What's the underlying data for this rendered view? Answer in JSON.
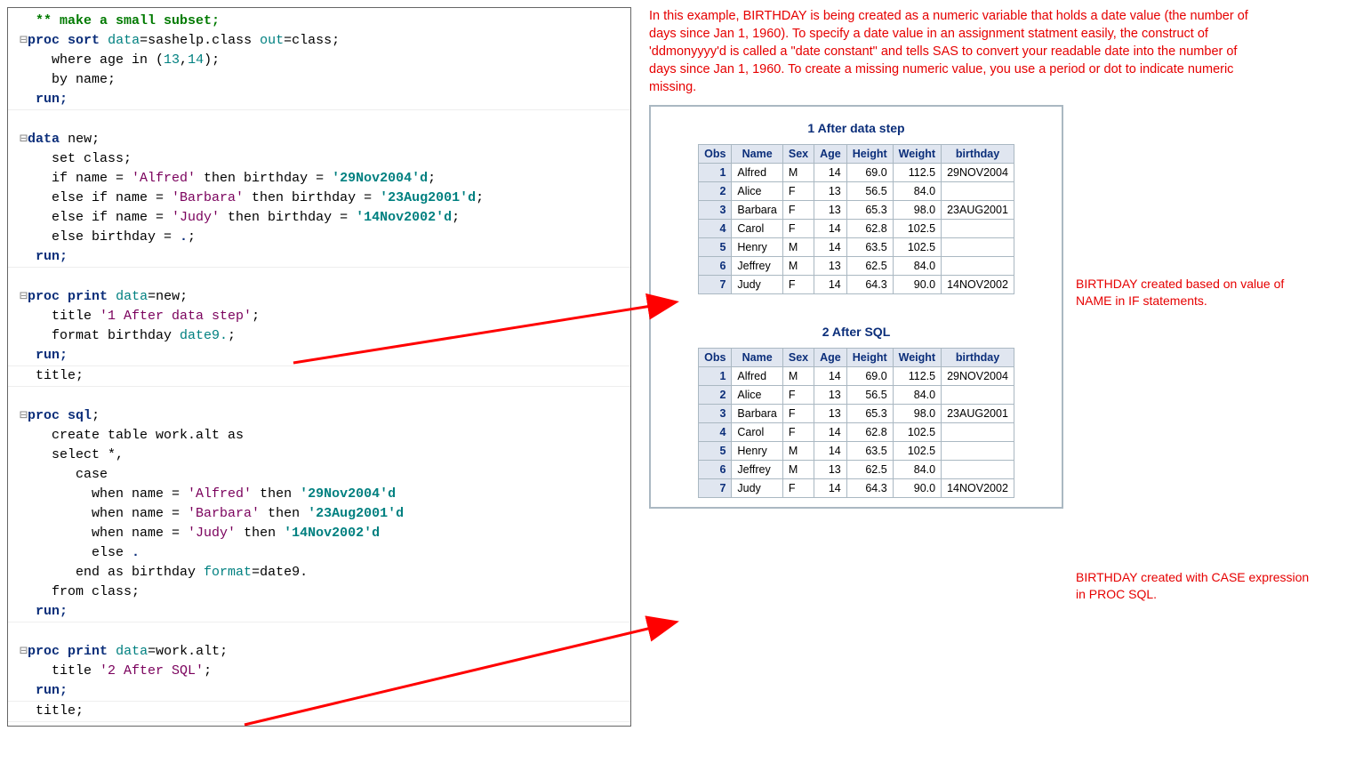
{
  "code": {
    "c01": "   ** make a small subset;",
    "c02a": " ⊟",
    "c02b": "proc sort",
    "c02c": " data",
    "c02d": "=sashelp.class ",
    "c02e": "out",
    "c02f": "=class;",
    "c03a": "     where age in (",
    "c03b": "13",
    "c03c": ",",
    "c03d": "14",
    "c03e": ");",
    "c04": "     by name;",
    "c05": "   run;",
    "c06": "",
    "c07a": " ⊟",
    "c07b": "data",
    "c07c": " new;",
    "c08": "     set class;",
    "c09a": "     if name = ",
    "c09b": "'Alfred'",
    "c09c": " then birthday = ",
    "c09d": "'29Nov2004'd",
    "c09e": ";",
    "c10a": "     else if name = ",
    "c10b": "'Barbara'",
    "c10c": " then birthday = ",
    "c10d": "'23Aug2001'd",
    "c10e": ";",
    "c11a": "     else if name = ",
    "c11b": "'Judy'",
    "c11c": " then birthday = ",
    "c11d": "'14Nov2002'd",
    "c11e": ";",
    "c12a": "     else birthday = ",
    "c12b": ".",
    "c12c": ";",
    "c13": "   run;",
    "c14": "",
    "c15a": " ⊟",
    "c15b": "proc print",
    "c15c": " data",
    "c15d": "=new;",
    "c16a": "     title ",
    "c16b": "'1 After data step'",
    "c16c": ";",
    "c17a": "     format birthday ",
    "c17b": "date9.",
    "c17c": ";",
    "c18": "   run;",
    "c19": "   title;",
    "c20": "",
    "c21a": " ⊟",
    "c21b": "proc sql",
    "c21c": ";",
    "c22": "     create table work.alt as",
    "c23": "     select *,",
    "c24": "        case",
    "c25a": "          when name = ",
    "c25b": "'Alfred'",
    "c25c": " then ",
    "c25d": "'29Nov2004'd",
    "c26a": "          when name = ",
    "c26b": "'Barbara'",
    "c26c": " then ",
    "c26d": "'23Aug2001'd",
    "c27a": "          when name = ",
    "c27b": "'Judy'",
    "c27c": " then ",
    "c27d": "'14Nov2002'd",
    "c28a": "          else ",
    "c28b": ".",
    "c29a": "        end as birthday ",
    "c29b": "format",
    "c29c": "=date9.",
    "c30": "     from class;",
    "c31": "   run;",
    "c32": "",
    "c33a": " ⊟",
    "c33b": "proc print",
    "c33c": " data",
    "c33d": "=work.alt;",
    "c34a": "     title ",
    "c34b": "'2 After SQL'",
    "c34c": ";",
    "c35": "   run;",
    "c36": "   title;"
  },
  "explain_top": "In this example, BIRTHDAY is being created as a numeric variable that holds a date value (the number of days since Jan 1, 1960). To specify a date value in an assignment statment easily, the construct of 'ddmonyyyy'd is called a \"date constant\" and tells SAS to convert your readable date into the number of days since Jan 1, 1960. To create a missing numeric value, you use a period or dot to indicate numeric missing.",
  "note1": "BIRTHDAY created based on value of NAME in IF statements.",
  "note2": "BIRTHDAY created with CASE expression in PROC SQL.",
  "out_title1": "1 After data step",
  "out_title2": "2 After SQL",
  "headers": {
    "obs": "Obs",
    "name": "Name",
    "sex": "Sex",
    "age": "Age",
    "height": "Height",
    "weight": "Weight",
    "bday": "birthday"
  },
  "rows": [
    {
      "obs": "1",
      "name": "Alfred",
      "sex": "M",
      "age": "14",
      "h": "69.0",
      "w": "112.5",
      "b": "29NOV2004"
    },
    {
      "obs": "2",
      "name": "Alice",
      "sex": "F",
      "age": "13",
      "h": "56.5",
      "w": "84.0",
      "b": "."
    },
    {
      "obs": "3",
      "name": "Barbara",
      "sex": "F",
      "age": "13",
      "h": "65.3",
      "w": "98.0",
      "b": "23AUG2001"
    },
    {
      "obs": "4",
      "name": "Carol",
      "sex": "F",
      "age": "14",
      "h": "62.8",
      "w": "102.5",
      "b": "."
    },
    {
      "obs": "5",
      "name": "Henry",
      "sex": "M",
      "age": "14",
      "h": "63.5",
      "w": "102.5",
      "b": "."
    },
    {
      "obs": "6",
      "name": "Jeffrey",
      "sex": "M",
      "age": "13",
      "h": "62.5",
      "w": "84.0",
      "b": "."
    },
    {
      "obs": "7",
      "name": "Judy",
      "sex": "F",
      "age": "14",
      "h": "64.3",
      "w": "90.0",
      "b": "14NOV2002"
    }
  ]
}
